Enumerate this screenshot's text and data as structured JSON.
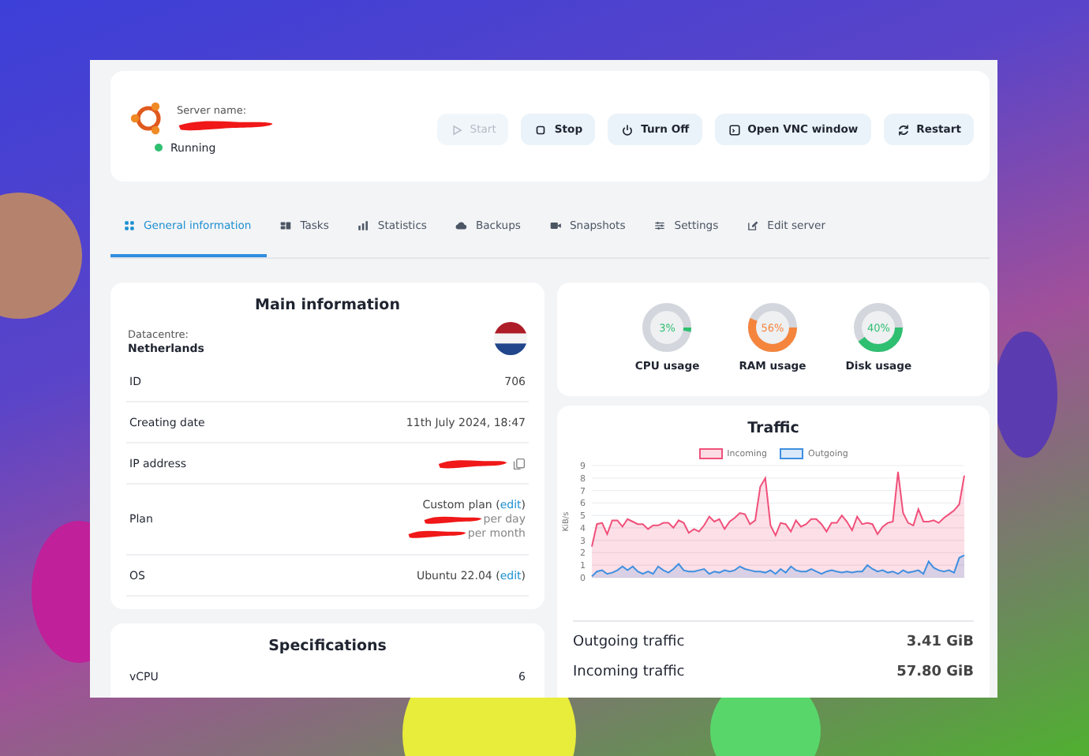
{
  "server": {
    "name_label": "Server name:",
    "status": {
      "label": "Running",
      "color": "#2fbf71"
    }
  },
  "buttons": [
    {
      "label": "Start",
      "disabled": true
    },
    {
      "label": "Stop",
      "disabled": false
    },
    {
      "label": "Turn Off",
      "disabled": false
    },
    {
      "label": "Open VNC window",
      "disabled": false
    },
    {
      "label": "Restart",
      "disabled": false
    }
  ],
  "tabs": [
    {
      "label": "General information",
      "selected": true
    },
    {
      "label": "Tasks",
      "selected": false
    },
    {
      "label": "Statistics",
      "selected": false
    },
    {
      "label": "Backups",
      "selected": false
    },
    {
      "label": "Snapshots",
      "selected": false
    },
    {
      "label": "Settings",
      "selected": false
    },
    {
      "label": "Edit server",
      "selected": false
    }
  ],
  "main_information": {
    "title": "Main information",
    "datacentre_label": "Datacentre:",
    "datacentre": "Netherlands",
    "rows": [
      {
        "kind": "text",
        "label": "ID",
        "value": "706"
      },
      {
        "kind": "text",
        "label": "Creating date",
        "value": "11th July 2024, 18:47"
      },
      {
        "kind": "ip",
        "label": "IP address"
      },
      {
        "kind": "plan",
        "label": "Plan",
        "value": "Custom plan (",
        "link": "edit",
        "suffix": ")",
        "lines": [
          "per day",
          "per month"
        ]
      },
      {
        "kind": "link",
        "label": "OS",
        "value": "Ubuntu 22.04 (",
        "link": "edit",
        "suffix": ")"
      }
    ]
  },
  "specifications": {
    "title": "Specifications",
    "rows": [
      {
        "label": "vCPU",
        "value": "6"
      }
    ]
  },
  "usage": [
    {
      "label": "CPU usage",
      "reading": "3%",
      "level": 0.03,
      "color": "#2fbf71"
    },
    {
      "label": "RAM usage",
      "reading": "56%",
      "level": 0.56,
      "color": "#f5843d"
    },
    {
      "label": "Disk usage",
      "reading": "40%",
      "level": 0.4,
      "color": "#2fbf71"
    }
  ],
  "traffic": {
    "title": "Traffic",
    "chart_data": {
      "type": "area",
      "grid": true,
      "legend": true,
      "ylabel": "KiB/s",
      "ylim": [
        0,
        9
      ],
      "yticks": [
        0,
        1,
        2,
        3,
        4,
        5,
        6,
        7,
        8,
        9
      ],
      "series": [
        {
          "name": "Incoming",
          "color": "#f0507a",
          "values": [
            2.5,
            4.3,
            4.4,
            3.5,
            4.6,
            4.6,
            4.1,
            4.7,
            4.5,
            4.3,
            4.3,
            3.9,
            4.2,
            4.2,
            4.4,
            4.4,
            4.0,
            4.6,
            4.4,
            3.6,
            3.9,
            3.7,
            4.2,
            4.9,
            4.5,
            4.7,
            3.9,
            4.5,
            4.8,
            5.2,
            5.1,
            4.3,
            4.6,
            7.3,
            8.0,
            4.2,
            3.4,
            4.4,
            4.3,
            3.7,
            4.6,
            4.1,
            4.3,
            4.7,
            4.7,
            4.3,
            3.7,
            4.4,
            4.4,
            5.0,
            4.5,
            3.8,
            4.9,
            4.3,
            4.4,
            4.3,
            3.5,
            4.1,
            4.4,
            4.5,
            8.5,
            5.2,
            4.4,
            4.2,
            5.5,
            4.5,
            4.5,
            4.6,
            4.4,
            4.8,
            5.1,
            5.4,
            5.9,
            8.2
          ]
        },
        {
          "name": "Outgoing",
          "color": "#3f8fe0",
          "values": [
            0.1,
            0.5,
            0.6,
            0.3,
            0.4,
            0.6,
            0.9,
            0.6,
            0.9,
            0.5,
            0.3,
            0.5,
            0.3,
            0.9,
            0.6,
            0.4,
            0.7,
            1.1,
            0.6,
            0.5,
            0.5,
            0.6,
            0.7,
            0.3,
            0.5,
            0.4,
            0.6,
            0.5,
            0.6,
            0.9,
            0.7,
            0.6,
            0.5,
            0.5,
            0.4,
            0.6,
            0.3,
            0.7,
            0.4,
            0.9,
            0.6,
            0.5,
            0.5,
            0.7,
            0.5,
            0.3,
            0.5,
            0.6,
            0.5,
            0.4,
            0.5,
            0.4,
            0.5,
            0.5,
            1.0,
            0.7,
            0.5,
            0.6,
            0.4,
            0.5,
            0.3,
            0.6,
            0.4,
            0.5,
            0.6,
            0.3,
            1.3,
            0.8,
            0.6,
            0.5,
            0.6,
            0.4,
            1.6,
            1.8
          ]
        }
      ]
    },
    "totals": [
      {
        "label": "Outgoing traffic",
        "value": "3.41 GiB"
      },
      {
        "label": "Incoming traffic",
        "value": "57.80 GiB"
      }
    ]
  }
}
